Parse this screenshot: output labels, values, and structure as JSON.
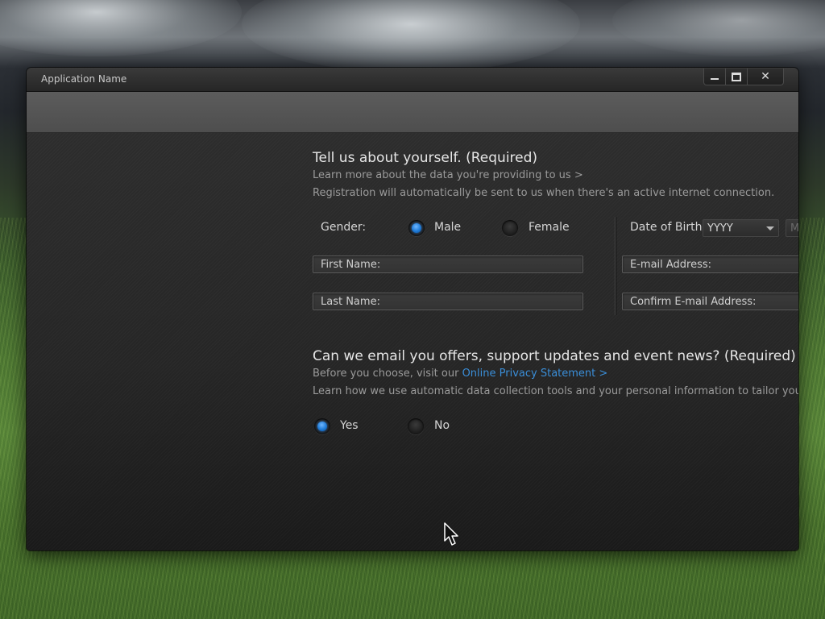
{
  "window": {
    "title": "Application Name",
    "minimize_icon": "minimize-icon",
    "maximize_icon": "maximize-icon",
    "close_label": "✕"
  },
  "section1": {
    "heading": "Tell us about yourself. (Required)",
    "learn_more_link": "Learn more about the data you're providing to us >",
    "note": "Registration will automatically be sent to us when there's an active internet connection."
  },
  "gender": {
    "label": "Gender:",
    "options": [
      {
        "label": "Male",
        "selected": true
      },
      {
        "label": "Female",
        "selected": false
      }
    ]
  },
  "dob": {
    "label": "Date of Birth:",
    "year_value": "YYYY",
    "month_value": "MM"
  },
  "fields": {
    "first_name": "First Name:",
    "last_name": "Last Name:",
    "email": "E-mail Address:",
    "confirm_email": "Confirm E-mail Address:"
  },
  "section2": {
    "heading": "Can we email you offers, support updates and event news? (Required)",
    "before_text": "Before you choose, visit our ",
    "privacy_link": "Online Privacy Statement >",
    "note": "Learn how we use automatic data collection tools and your personal information to tailor your co"
  },
  "email_opt": {
    "options": [
      {
        "label": "Yes",
        "selected": true
      },
      {
        "label": "No",
        "selected": false
      }
    ]
  },
  "colors": {
    "accent": "#3a8ed8",
    "radio_on": "#1e7ad6"
  }
}
